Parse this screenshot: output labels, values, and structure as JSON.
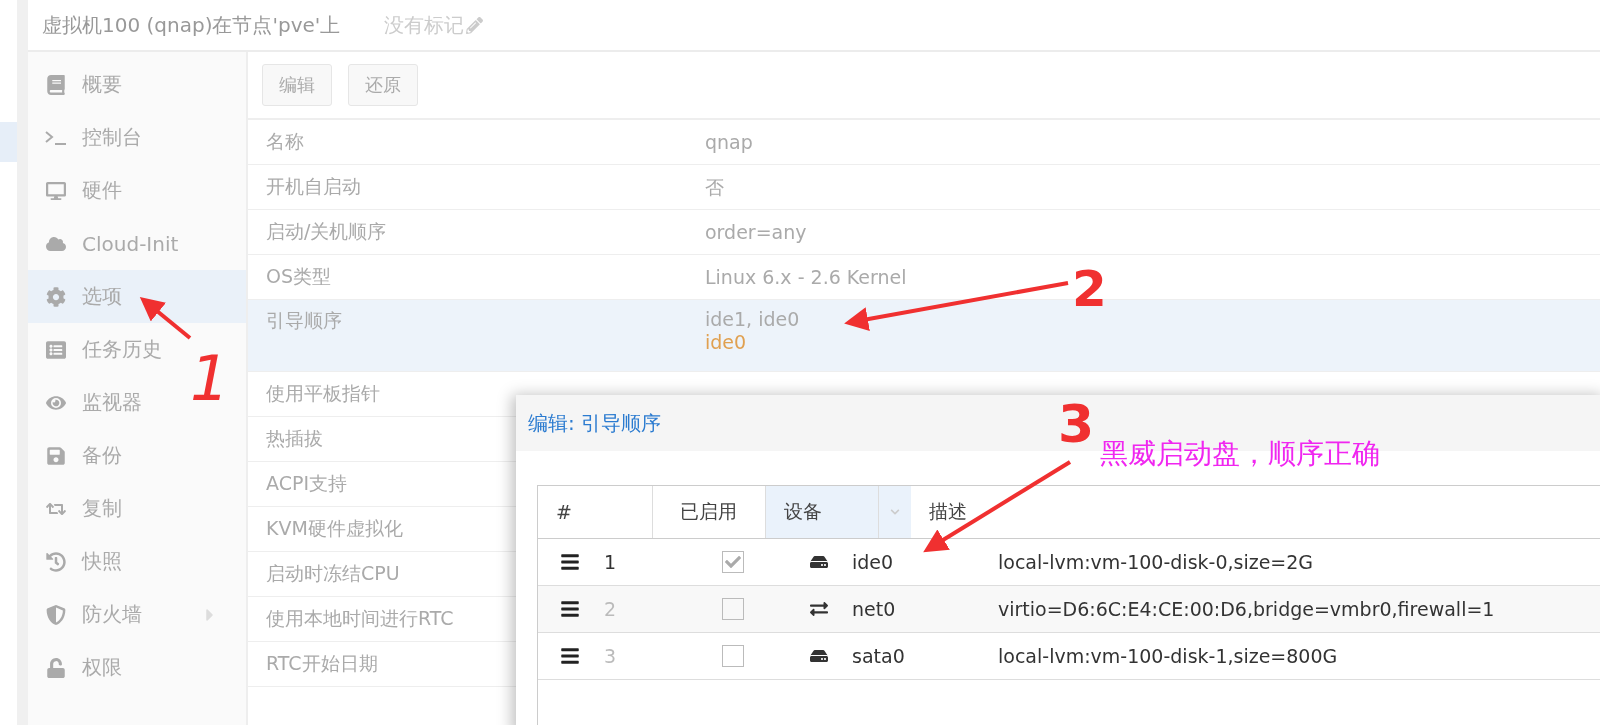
{
  "header": {
    "title": "虚拟机100 (qnap)在节点'pve'上",
    "tags": "没有标记"
  },
  "sidebar": {
    "items": [
      {
        "label": "概要",
        "selected": false,
        "submenu": false
      },
      {
        "label": "控制台",
        "selected": false,
        "submenu": false
      },
      {
        "label": "硬件",
        "selected": false,
        "submenu": false
      },
      {
        "label": "Cloud-Init",
        "selected": false,
        "submenu": false
      },
      {
        "label": "选项",
        "selected": true,
        "submenu": false
      },
      {
        "label": "任务历史",
        "selected": false,
        "submenu": false
      },
      {
        "label": "监视器",
        "selected": false,
        "submenu": false
      },
      {
        "label": "备份",
        "selected": false,
        "submenu": false
      },
      {
        "label": "复制",
        "selected": false,
        "submenu": false
      },
      {
        "label": "快照",
        "selected": false,
        "submenu": false
      },
      {
        "label": "防火墙",
        "selected": false,
        "submenu": true
      },
      {
        "label": "权限",
        "selected": false,
        "submenu": false
      }
    ]
  },
  "toolbar": {
    "buttons": [
      "编辑",
      "还原"
    ]
  },
  "options": [
    {
      "name": "名称",
      "value": "qnap",
      "selected": false
    },
    {
      "name": "开机自启动",
      "value": "否",
      "selected": false
    },
    {
      "name": "启动/关机顺序",
      "value": "order=any",
      "selected": false
    },
    {
      "name": "OS类型",
      "value": "Linux 6.x - 2.6 Kernel",
      "selected": false
    },
    {
      "name": "引导顺序",
      "value": "ide1, ide0",
      "pending": "ide0",
      "selected": true
    },
    {
      "name": "使用平板指针",
      "selected": false
    },
    {
      "name": "热插拔",
      "selected": false
    },
    {
      "name": "ACPI支持",
      "selected": false
    },
    {
      "name": "KVM硬件虚拟化",
      "selected": false
    },
    {
      "name": "启动时冻结CPU",
      "selected": false
    },
    {
      "name": "使用本地时间进行RTC",
      "selected": false
    },
    {
      "name": "RTC开始日期",
      "selected": false
    }
  ],
  "dialog": {
    "title": "编辑: 引导顺序",
    "columns": [
      {
        "label": "#",
        "selected": false
      },
      {
        "label": "已启用",
        "selected": false
      },
      {
        "label": "设备",
        "selected": true
      },
      {
        "label": "描述",
        "selected": false
      }
    ],
    "rows": [
      {
        "index": "1",
        "enabled": true,
        "kind": "disk",
        "device": "ide0",
        "description": "local-lvm:vm-100-disk-0,size=2G"
      },
      {
        "index": "2",
        "enabled": false,
        "kind": "network",
        "device": "net0",
        "description": "virtio=D6:6C:E4:CE:00:D6,bridge=vmbr0,firewall=1"
      },
      {
        "index": "3",
        "enabled": false,
        "kind": "disk",
        "device": "sata0",
        "description": "local-lvm:vm-100-disk-1,size=800G"
      }
    ]
  },
  "annotations": [
    {
      "text": "1"
    },
    {
      "text": "2"
    },
    {
      "text": "3"
    },
    {
      "text": "黑威启动盘，顺序正确"
    }
  ]
}
